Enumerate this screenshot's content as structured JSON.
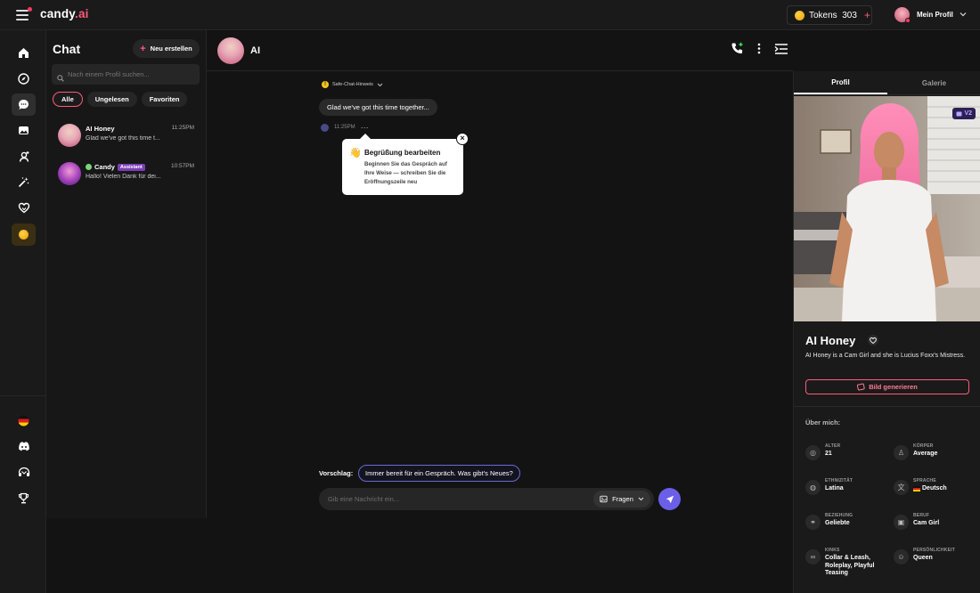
{
  "topbar": {
    "logo_main": "candy",
    "logo_suffix": ".ai",
    "tokens_label": "Tokens",
    "tokens_count": "303",
    "tokens_plus": "+",
    "profile_label": "Mein Profil"
  },
  "chatlist": {
    "title": "Chat",
    "new_button": "Neu erstellen",
    "search_placeholder": "Nach einem Profil suchen...",
    "filters": [
      "Alle",
      "Ungelesen",
      "Favoriten"
    ],
    "conversations": [
      {
        "name": "AI Honey",
        "time": "11:25PM",
        "preview": "Glad we've got this time t..."
      },
      {
        "name": "Candy",
        "badge": "Assistant",
        "time": "10:57PM",
        "preview": "Hallo! Vielen Dank für dei..."
      }
    ]
  },
  "chat": {
    "name": "AI",
    "safe_notice": "Safe-Chat-Hinweis",
    "message": "Glad we've got this time together...",
    "message_time": "11:25PM",
    "message_more": "···",
    "tooltip": {
      "emoji": "👋",
      "title": "Begrüßung bearbeiten",
      "body": "Beginnen Sie das Gespräch auf Ihre Weise — schreiben Sie die Eröffnungszeile neu",
      "close": "×"
    },
    "suggest_label": "Vorschlag:",
    "suggestion": "Immer bereit für ein Gespräch. Was gibt's Neues?",
    "input_placeholder": "Gib eine Nachricht ein...",
    "ask_label": "Fragen"
  },
  "profile": {
    "tabs": [
      "Profil",
      "Galerie"
    ],
    "version_badge": "V2",
    "name": "AI Honey",
    "description": "AI Honey is a Cam Girl and she is Lucius Foxx's Mistress.",
    "generate_button": "Bild generieren",
    "about_title": "Über mich:",
    "attributes": [
      {
        "label": "ALTER",
        "value": "21"
      },
      {
        "label": "KÖRPER",
        "value": "Average"
      },
      {
        "label": "ETHNIZITÄT",
        "value": "Latina"
      },
      {
        "label": "SPRACHE",
        "value": "Deutsch"
      },
      {
        "label": "BEZIEHUNG",
        "value": "Geliebte"
      },
      {
        "label": "BERUF",
        "value": "Cam Girl"
      },
      {
        "label": "KINKS",
        "value": "Collar & Leash, Roleplay, Playful Teasing"
      },
      {
        "label": "PERSÖNLICHKEIT",
        "value": "Queen"
      }
    ]
  },
  "colors": {
    "accent": "#ff5a7a",
    "send": "#6b5fe8",
    "background": "#131313"
  }
}
